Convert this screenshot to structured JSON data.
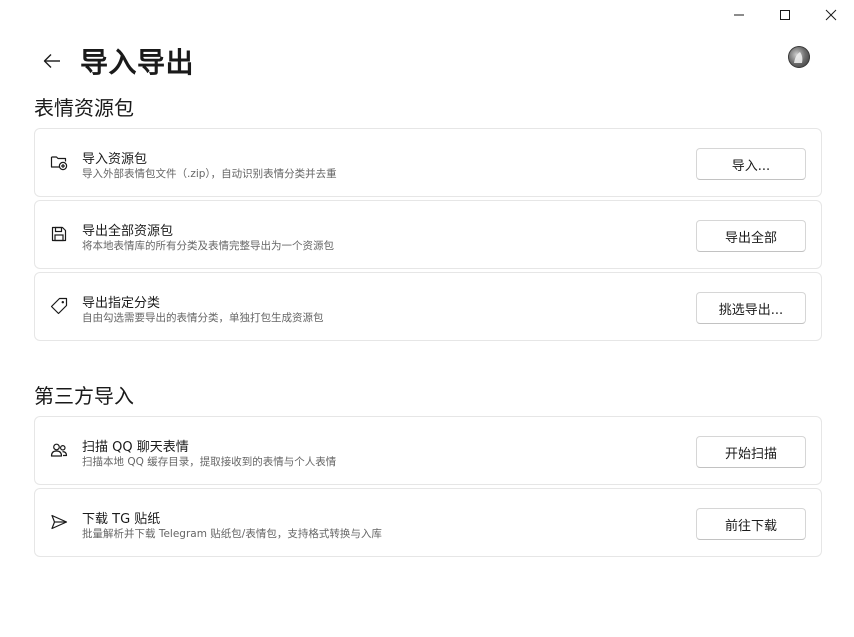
{
  "window": {
    "icons": [
      "minimize-icon",
      "maximize-icon",
      "close-icon"
    ]
  },
  "header": {
    "back_icon": "arrow-left-icon",
    "title": "导入导出"
  },
  "sections": [
    {
      "title": "表情资源包",
      "cards": [
        {
          "icon": "folder-plus-icon",
          "title": "导入资源包",
          "desc": "导入外部表情包文件（.zip），自动识别表情分类并去重",
          "button": "导入..."
        },
        {
          "icon": "save-icon",
          "title": "导出全部资源包",
          "desc": "将本地表情库的所有分类及表情完整导出为一个资源包",
          "button": "导出全部"
        },
        {
          "icon": "tag-icon",
          "title": "导出指定分类",
          "desc": "自由勾选需要导出的表情分类，单独打包生成资源包",
          "button": "挑选导出..."
        }
      ]
    },
    {
      "title": "第三方导入",
      "cards": [
        {
          "icon": "people-icon",
          "title": "扫描 QQ 聊天表情",
          "desc": "扫描本地 QQ 缓存目录，提取接收到的表情与个人表情",
          "button": "开始扫描"
        },
        {
          "icon": "send-icon",
          "title": "下载 TG 贴纸",
          "desc": "批量解析并下载 Telegram 贴纸包/表情包，支持格式转换与入库",
          "button": "前往下载"
        }
      ]
    }
  ]
}
